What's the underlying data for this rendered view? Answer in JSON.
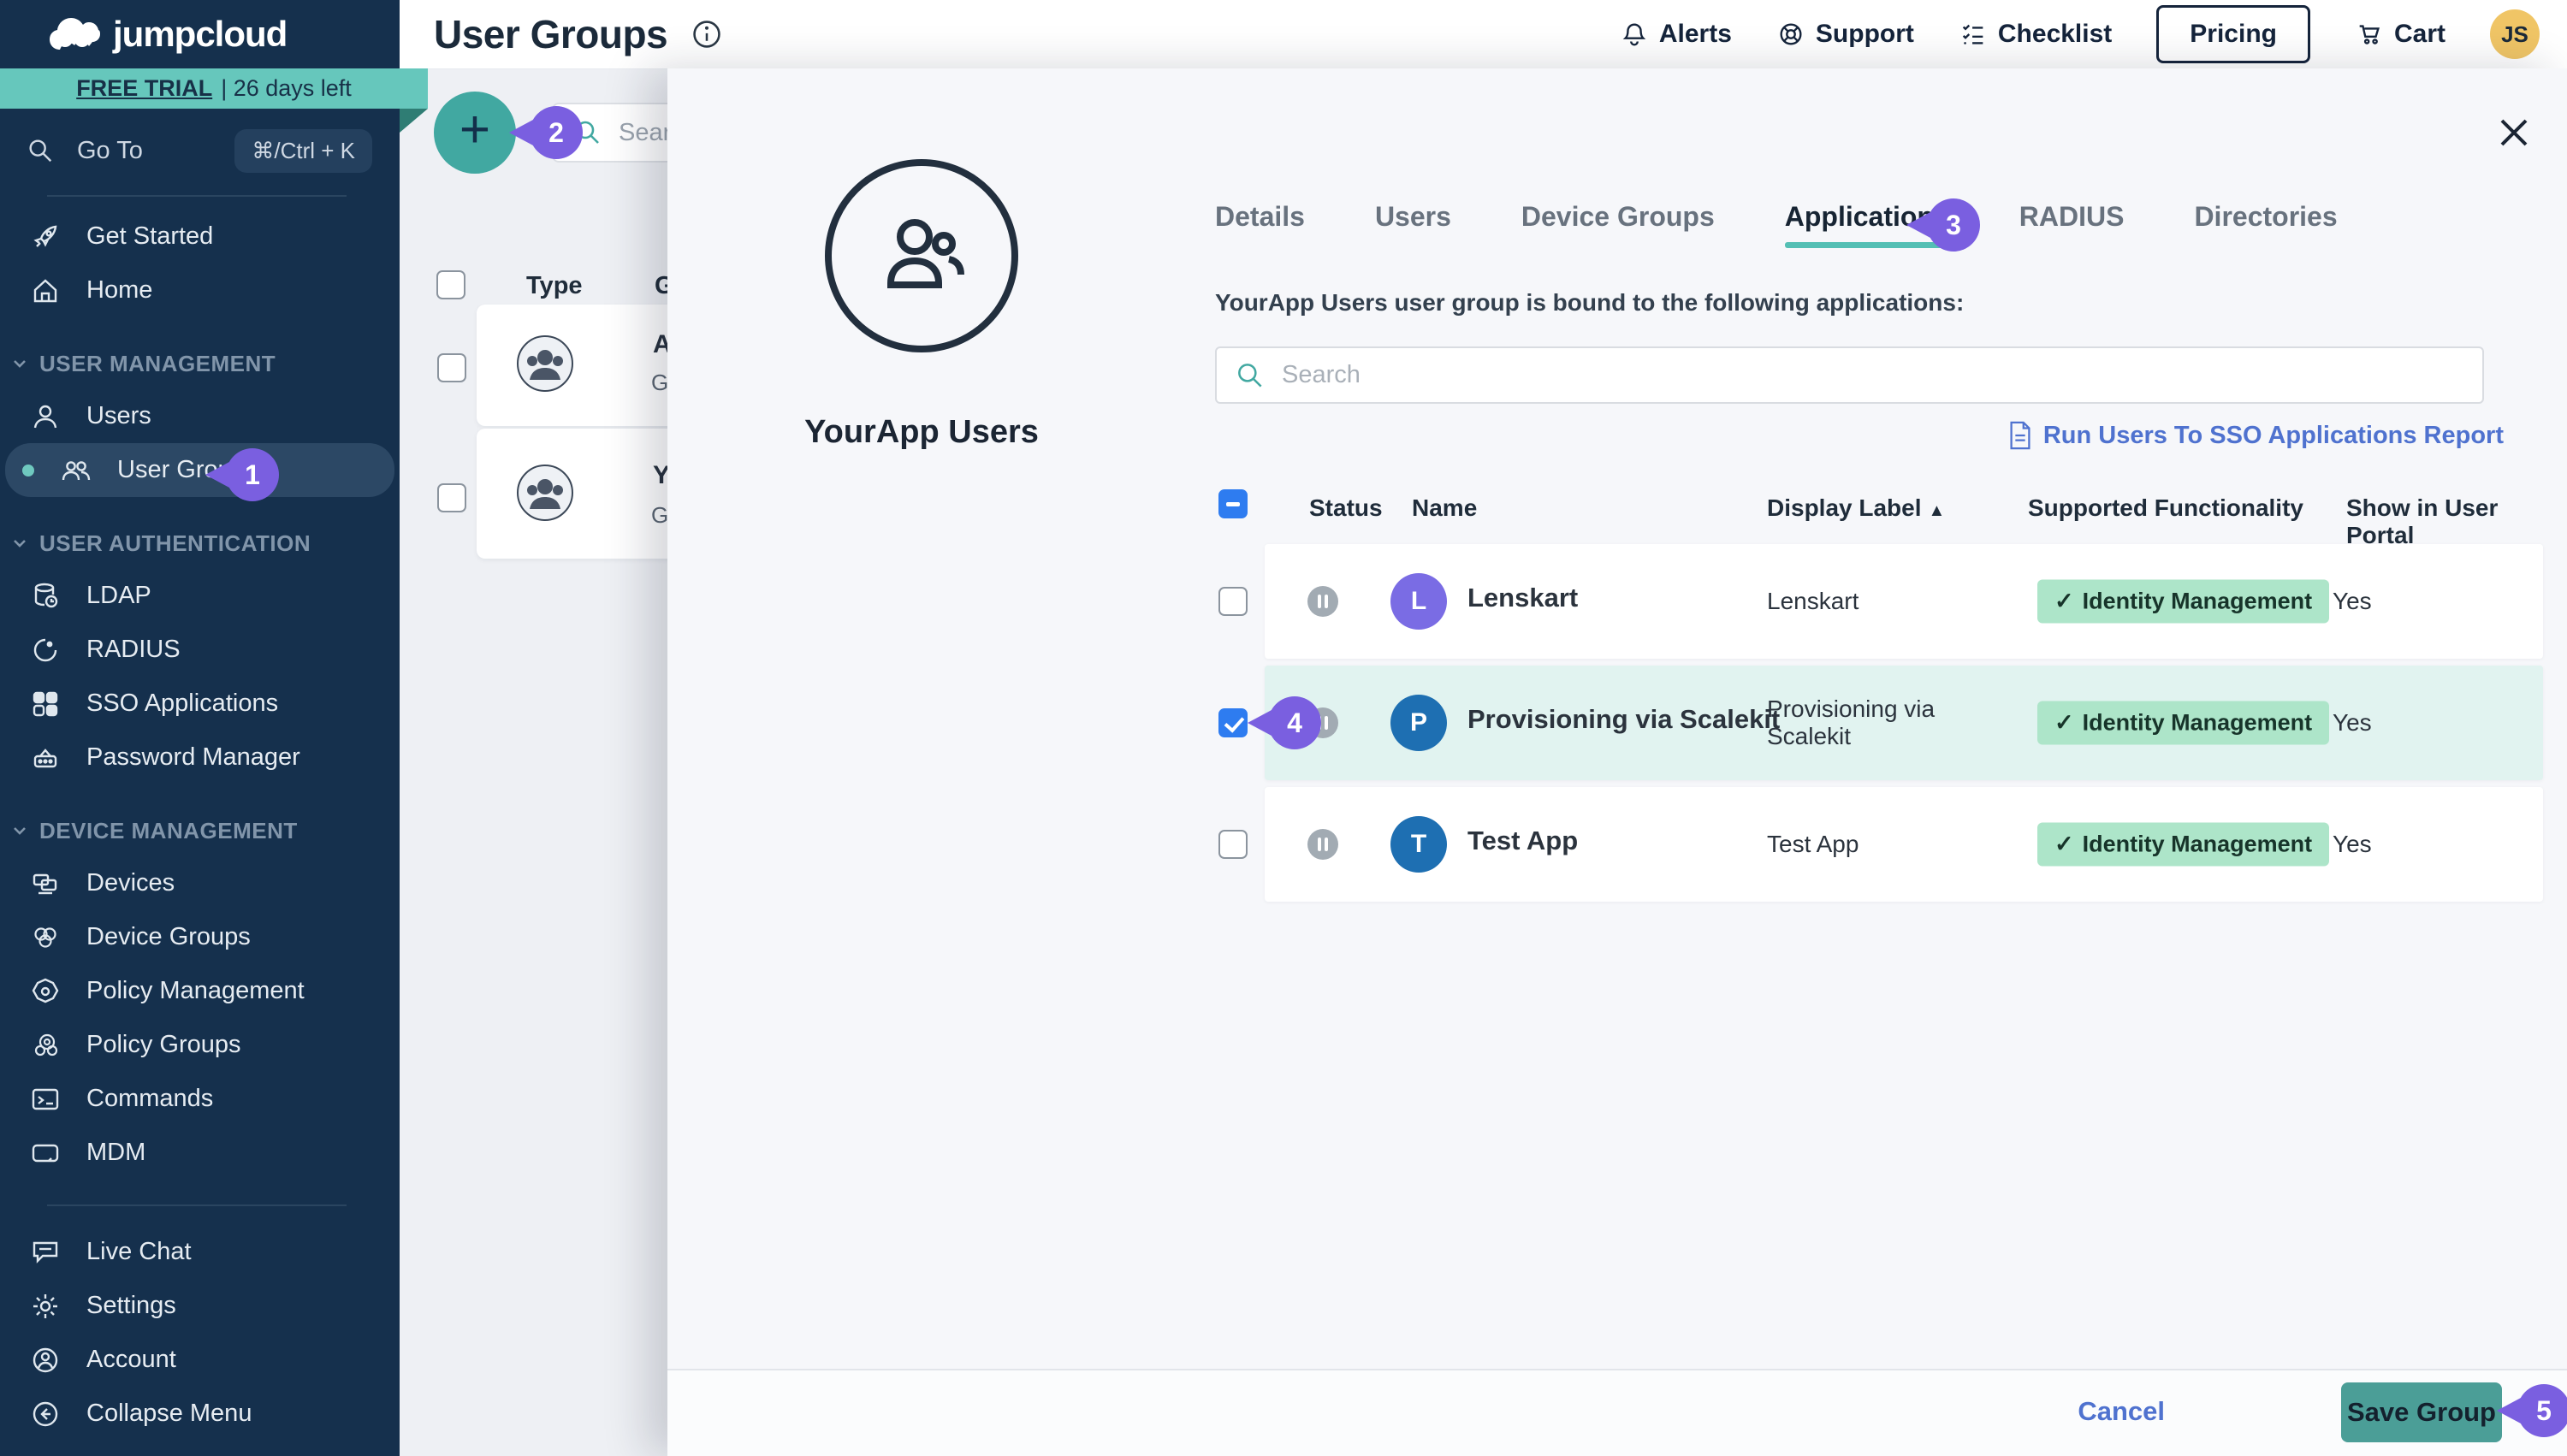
{
  "colors": {
    "sidebar_navy": "#15304d",
    "teal_banner": "#66c7bc",
    "teal_button": "#41a8a1",
    "save_teal": "#4b9e97",
    "badge_purple": "#7a5fe0",
    "checkbox_blue": "#2e7cf0",
    "link_blue": "#4f72cf",
    "pill_green": "#ade5c9",
    "row_highlight": "#e1f3f0",
    "avatar_purple": "#7a6ce4",
    "avatar_blue": "#1e6fb2"
  },
  "brand": {
    "name": "jumpcloud",
    "trial": "FREE TRIAL",
    "trial_days": "| 26 days left"
  },
  "goto": {
    "label": "Go To",
    "shortcut": "⌘/Ctrl + K"
  },
  "sidebar": {
    "primary": [
      {
        "label": "Get Started"
      },
      {
        "label": "Home"
      }
    ],
    "sections": [
      {
        "title": "USER MANAGEMENT",
        "items": [
          {
            "label": "Users"
          },
          {
            "label": "User Groups"
          }
        ]
      },
      {
        "title": "USER AUTHENTICATION",
        "items": [
          {
            "label": "LDAP"
          },
          {
            "label": "RADIUS"
          },
          {
            "label": "SSO Applications"
          },
          {
            "label": "Password Manager"
          }
        ]
      },
      {
        "title": "DEVICE MANAGEMENT",
        "items": [
          {
            "label": "Devices"
          },
          {
            "label": "Device Groups"
          },
          {
            "label": "Policy Management"
          },
          {
            "label": "Policy Groups"
          },
          {
            "label": "Commands"
          },
          {
            "label": "MDM"
          }
        ]
      }
    ],
    "footer": [
      {
        "label": "Live Chat"
      },
      {
        "label": "Settings"
      },
      {
        "label": "Account"
      },
      {
        "label": "Collapse Menu"
      }
    ]
  },
  "topbar": {
    "title": "User Groups",
    "nav": [
      {
        "label": "Alerts"
      },
      {
        "label": "Support"
      },
      {
        "label": "Checklist"
      },
      {
        "label": "Pricing"
      },
      {
        "label": "Cart"
      }
    ],
    "avatar": "JS"
  },
  "backdrop": {
    "search_placeholder": "Search",
    "col_type": "Type",
    "col_group": "G",
    "rows": [
      {
        "name": "A",
        "sub": "G"
      },
      {
        "name": "Y",
        "sub": "G"
      }
    ]
  },
  "badges": {
    "b1": "1",
    "b2": "2",
    "b3": "3",
    "b4": "4",
    "b5": "5"
  },
  "panel": {
    "tabs": [
      {
        "label": "Details"
      },
      {
        "label": "Users"
      },
      {
        "label": "Device Groups"
      },
      {
        "label": "Applications"
      },
      {
        "label": "RADIUS"
      },
      {
        "label": "Directories"
      }
    ],
    "active_tab": "Applications",
    "group_name": "YourApp Users",
    "description": "YourApp Users user group is bound to the following applications:",
    "search_placeholder": "Search",
    "report_link": "Run Users To SSO Applications Report",
    "table": {
      "headers": {
        "status": "Status",
        "name": "Name",
        "display_label": "Display Label",
        "functionality": "Supported Functionality",
        "portal": "Show in User Portal"
      },
      "sort": {
        "column": "Display Label",
        "direction": "asc",
        "arrow": "▲"
      },
      "check_glyph": "✓",
      "rows": [
        {
          "initial": "L",
          "name": "Lenskart",
          "display_label": "Lenskart",
          "functionality": "Identity Management",
          "portal": "Yes",
          "status": "paused",
          "checked": false
        },
        {
          "initial": "P",
          "name": "Provisioning via Scalekit",
          "display_label": "Provisioning via Scalekit",
          "functionality": "Identity Management",
          "portal": "Yes",
          "status": "paused",
          "checked": true
        },
        {
          "initial": "T",
          "name": "Test App",
          "display_label": "Test App",
          "functionality": "Identity Management",
          "portal": "Yes",
          "status": "paused",
          "checked": false
        }
      ]
    },
    "footer": {
      "cancel": "Cancel",
      "save": "Save Group"
    }
  }
}
